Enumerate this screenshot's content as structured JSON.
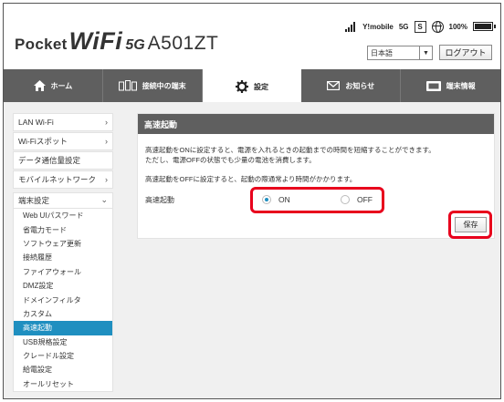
{
  "brand": {
    "pocket": "Pocket",
    "wifi": "WiFi",
    "g5": "5G",
    "model": "A501ZT"
  },
  "status": {
    "carrier": "Y!mobile",
    "network": "5G",
    "sim": "S",
    "battery": "100%",
    "battery_level": 1.0,
    "signal_bars": 4
  },
  "header": {
    "language": "日本語",
    "logout_label": "ログアウト"
  },
  "nav": {
    "tabs": [
      {
        "label": "ホーム",
        "icon": "home-icon"
      },
      {
        "label": "接続中の端末",
        "icon": "devices-icon"
      },
      {
        "label": "設定",
        "icon": "gear-icon",
        "active": true
      },
      {
        "label": "お知らせ",
        "icon": "mail-icon"
      },
      {
        "label": "端末情報",
        "icon": "device-info-icon"
      }
    ]
  },
  "sidebar": {
    "items": [
      {
        "label": "LAN Wi-Fi"
      },
      {
        "label": "Wi-Fiスポット"
      },
      {
        "label": "データ通信量設定"
      },
      {
        "label": "モバイルネットワーク"
      }
    ],
    "group": {
      "label": "端末設定",
      "children": [
        "Web UIパスワード",
        "省電力モード",
        "ソフトウェア更新",
        "接続履歴",
        "ファイアウォール",
        "DMZ設定",
        "ドメインフィルタ",
        "カスタム",
        "高速起動",
        "USB規格設定",
        "クレードル設定",
        "給電設定",
        "オールリセット"
      ],
      "active_index": 8
    }
  },
  "panel": {
    "title": "高速起動",
    "desc1": "高速起動をONに設定すると、電源を入れるときの起動までの時間を短縮することができます。",
    "desc2": "ただし、電源OFFの状態でも少量の電池を消費します。",
    "desc3": "高速起動をOFFに設定すると、起動の際通常より時間がかかります。",
    "field_label": "高速起動",
    "on_label": "ON",
    "off_label": "OFF",
    "selected": "ON",
    "save_label": "保存"
  },
  "colors": {
    "nav_bg": "#5f5f5f",
    "accent": "#1f8fc0",
    "highlight": "#e8001c"
  }
}
